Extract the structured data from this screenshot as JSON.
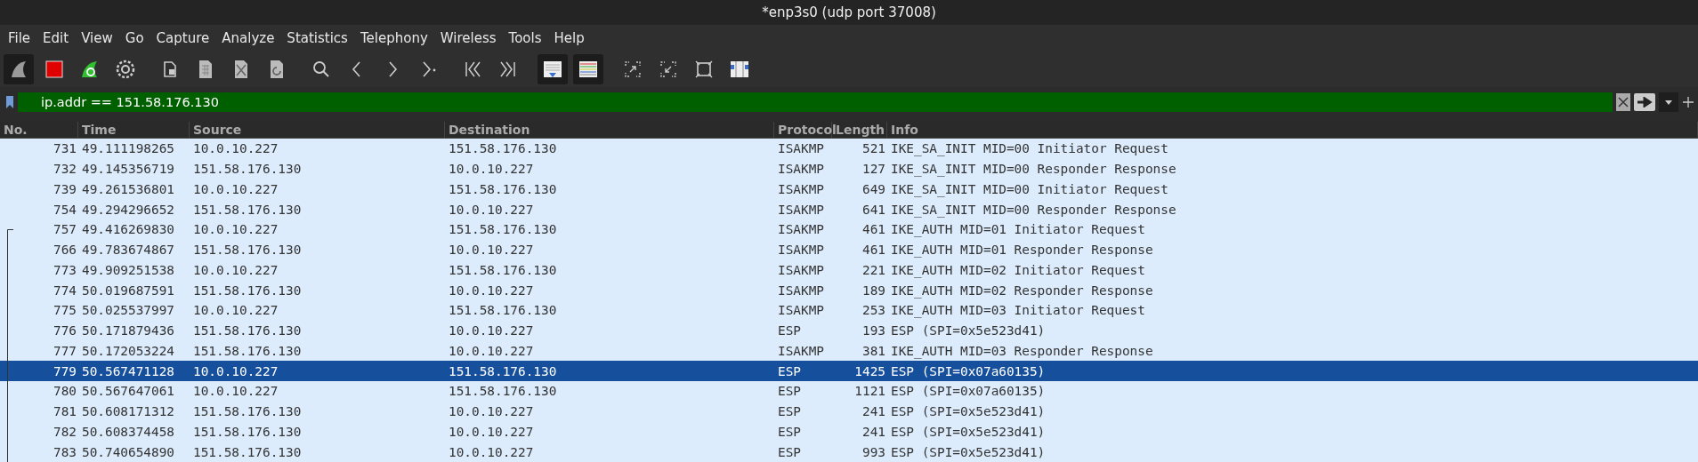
{
  "window": {
    "title": "*enp3s0 (udp port 37008)"
  },
  "menu": [
    "File",
    "Edit",
    "View",
    "Go",
    "Capture",
    "Analyze",
    "Statistics",
    "Telephony",
    "Wireless",
    "Tools",
    "Help"
  ],
  "toolbar": [
    {
      "kind": "start",
      "pressed": true
    },
    {
      "kind": "stop",
      "pressed": false
    },
    {
      "kind": "restart",
      "pressed": false
    },
    {
      "kind": "options",
      "pressed": false
    },
    {
      "kind": "open",
      "pressed": false
    },
    {
      "kind": "save",
      "pressed": false
    },
    {
      "kind": "close",
      "pressed": false
    },
    {
      "kind": "reload",
      "pressed": false
    },
    {
      "kind": "find",
      "pressed": false
    },
    {
      "kind": "back",
      "pressed": false
    },
    {
      "kind": "forward",
      "pressed": false
    },
    {
      "kind": "goto",
      "pressed": false
    },
    {
      "kind": "first",
      "pressed": false
    },
    {
      "kind": "last",
      "pressed": false
    },
    {
      "kind": "autoscroll",
      "pressed": true
    },
    {
      "kind": "colorize",
      "pressed": true
    },
    {
      "kind": "zoomin",
      "pressed": false
    },
    {
      "kind": "zoomout",
      "pressed": false
    },
    {
      "kind": "normal",
      "pressed": false
    },
    {
      "kind": "resize",
      "pressed": false
    }
  ],
  "filter": {
    "value": "ip.addr == 151.58.176.130"
  },
  "table": {
    "columns": [
      "No.",
      "Time",
      "Source",
      "Destination",
      "Protocol",
      "Length",
      "Info"
    ],
    "rows": [
      {
        "no": "731",
        "time": "49.111198265",
        "source": "10.0.10.227",
        "destination": "151.58.176.130",
        "protocol": "ISAKMP",
        "length": "521",
        "info": "IKE_SA_INIT MID=00 Initiator Request",
        "selected": false
      },
      {
        "no": "732",
        "time": "49.145356719",
        "source": "151.58.176.130",
        "destination": "10.0.10.227",
        "protocol": "ISAKMP",
        "length": "127",
        "info": "IKE_SA_INIT MID=00 Responder Response",
        "selected": false
      },
      {
        "no": "739",
        "time": "49.261536801",
        "source": "10.0.10.227",
        "destination": "151.58.176.130",
        "protocol": "ISAKMP",
        "length": "649",
        "info": "IKE_SA_INIT MID=00 Initiator Request",
        "selected": false
      },
      {
        "no": "754",
        "time": "49.294296652",
        "source": "151.58.176.130",
        "destination": "10.0.10.227",
        "protocol": "ISAKMP",
        "length": "641",
        "info": "IKE_SA_INIT MID=00 Responder Response",
        "selected": false
      },
      {
        "no": "757",
        "time": "49.416269830",
        "source": "10.0.10.227",
        "destination": "151.58.176.130",
        "protocol": "ISAKMP",
        "length": "461",
        "info": "IKE_AUTH MID=01 Initiator Request",
        "selected": false
      },
      {
        "no": "766",
        "time": "49.783674867",
        "source": "151.58.176.130",
        "destination": "10.0.10.227",
        "protocol": "ISAKMP",
        "length": "461",
        "info": "IKE_AUTH MID=01 Responder Response",
        "selected": false
      },
      {
        "no": "773",
        "time": "49.909251538",
        "source": "10.0.10.227",
        "destination": "151.58.176.130",
        "protocol": "ISAKMP",
        "length": "221",
        "info": "IKE_AUTH MID=02 Initiator Request",
        "selected": false
      },
      {
        "no": "774",
        "time": "50.019687591",
        "source": "151.58.176.130",
        "destination": "10.0.10.227",
        "protocol": "ISAKMP",
        "length": "189",
        "info": "IKE_AUTH MID=02 Responder Response",
        "selected": false
      },
      {
        "no": "775",
        "time": "50.025537997",
        "source": "10.0.10.227",
        "destination": "151.58.176.130",
        "protocol": "ISAKMP",
        "length": "253",
        "info": "IKE_AUTH MID=03 Initiator Request",
        "selected": false
      },
      {
        "no": "776",
        "time": "50.171879436",
        "source": "151.58.176.130",
        "destination": "10.0.10.227",
        "protocol": "ESP",
        "length": "193",
        "info": "ESP (SPI=0x5e523d41)",
        "selected": false
      },
      {
        "no": "777",
        "time": "50.172053224",
        "source": "151.58.176.130",
        "destination": "10.0.10.227",
        "protocol": "ISAKMP",
        "length": "381",
        "info": "IKE_AUTH MID=03 Responder Response",
        "selected": false
      },
      {
        "no": "779",
        "time": "50.567471128",
        "source": "10.0.10.227",
        "destination": "151.58.176.130",
        "protocol": "ESP",
        "length": "1425",
        "info": "ESP (SPI=0x07a60135)",
        "selected": true
      },
      {
        "no": "780",
        "time": "50.567647061",
        "source": "10.0.10.227",
        "destination": "151.58.176.130",
        "protocol": "ESP",
        "length": "1121",
        "info": "ESP (SPI=0x07a60135)",
        "selected": false
      },
      {
        "no": "781",
        "time": "50.608171312",
        "source": "151.58.176.130",
        "destination": "10.0.10.227",
        "protocol": "ESP",
        "length": "241",
        "info": "ESP (SPI=0x5e523d41)",
        "selected": false
      },
      {
        "no": "782",
        "time": "50.608374458",
        "source": "151.58.176.130",
        "destination": "10.0.10.227",
        "protocol": "ESP",
        "length": "241",
        "info": "ESP (SPI=0x5e523d41)",
        "selected": false
      },
      {
        "no": "783",
        "time": "50.740654890",
        "source": "151.58.176.130",
        "destination": "10.0.10.227",
        "protocol": "ESP",
        "length": "993",
        "info": "ESP (SPI=0x5e523d41)",
        "selected": false
      }
    ]
  }
}
